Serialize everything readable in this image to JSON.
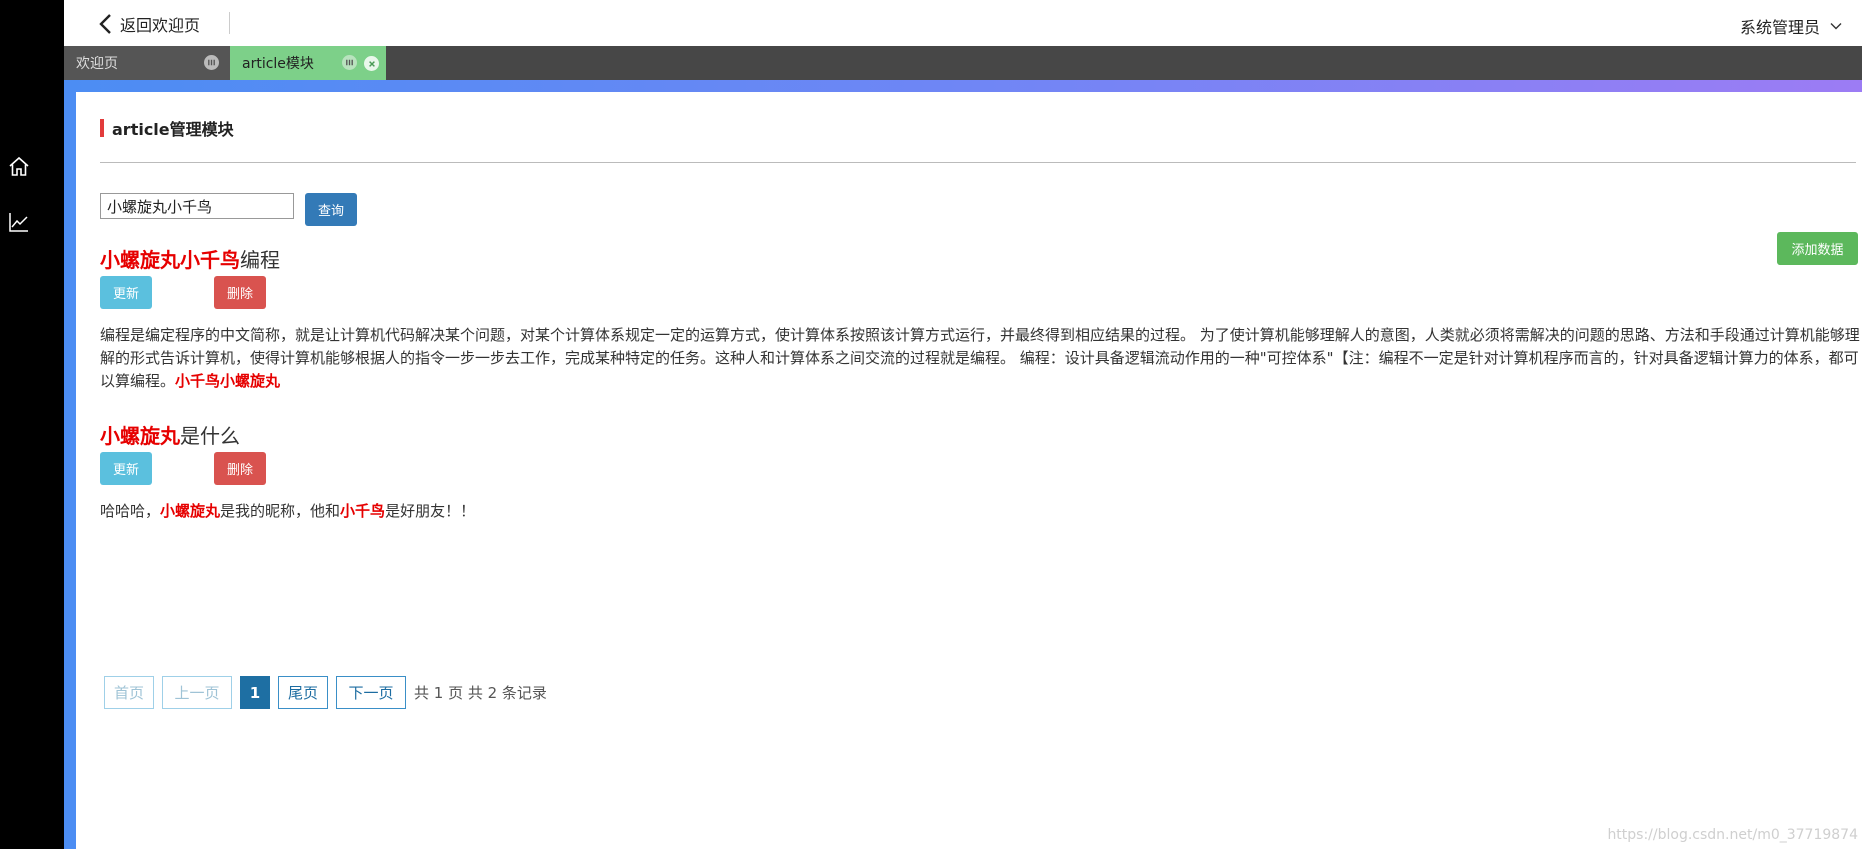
{
  "header": {
    "back_label": "返回欢迎页",
    "user_label": "系统管理员"
  },
  "tabs": [
    {
      "label": "欢迎页",
      "active": false
    },
    {
      "label": "article模块",
      "active": true
    }
  ],
  "sidebar": {
    "icons": [
      "home-icon",
      "chart-line-icon"
    ]
  },
  "module": {
    "title": "article管理模块"
  },
  "search": {
    "value": "小螺旋丸小千鸟",
    "button_label": "查询"
  },
  "add_button_label": "添加数据",
  "articles": [
    {
      "title_highlight": "小螺旋丸小千鸟",
      "title_rest": "编程",
      "update_label": "更新",
      "delete_label": "删除",
      "body": "编程是编定程序的中文简称，就是让计算机代码解决某个问题，对某个计算体系规定一定的运算方式，使计算体系按照该计算方式运行，并最终得到相应结果的过程。 为了使计算机能够理解人的意图，人类就必须将需解决的问题的思路、方法和手段通过计算机能够理解的形式告诉计算机，使得计算机能够根据人的指令一步一步去工作，完成某种特定的任务。这种人和计算体系之间交流的过程就是编程。 编程：设计具备逻辑流动作用的一种\"可控体系\"【注：编程不一定是针对计算机程序而言的，针对具备逻辑计算力的体系，都可以算编程。",
      "body_highlight": "小千鸟小螺旋丸"
    },
    {
      "title_highlight": "小螺旋丸",
      "title_rest": "是什么",
      "update_label": "更新",
      "delete_label": "删除",
      "body_parts": [
        "哈哈哈，",
        "小螺旋丸",
        "是我的昵称，他和",
        "小千鸟",
        "是好朋友！！"
      ]
    }
  ],
  "pagination": {
    "first": "首页",
    "prev": "上一页",
    "current": "1",
    "last": "尾页",
    "next": "下一页",
    "info": "共 1 页 共 2 条记录"
  },
  "watermark": "https://blog.csdn.net/m0_37719874",
  "colors": {
    "highlight": "#e60000",
    "query_button": "#337ab7",
    "add_button": "#5cb85c",
    "update_button": "#5bc0de",
    "delete_button": "#d9534f",
    "active_tab": "#7dd089"
  }
}
